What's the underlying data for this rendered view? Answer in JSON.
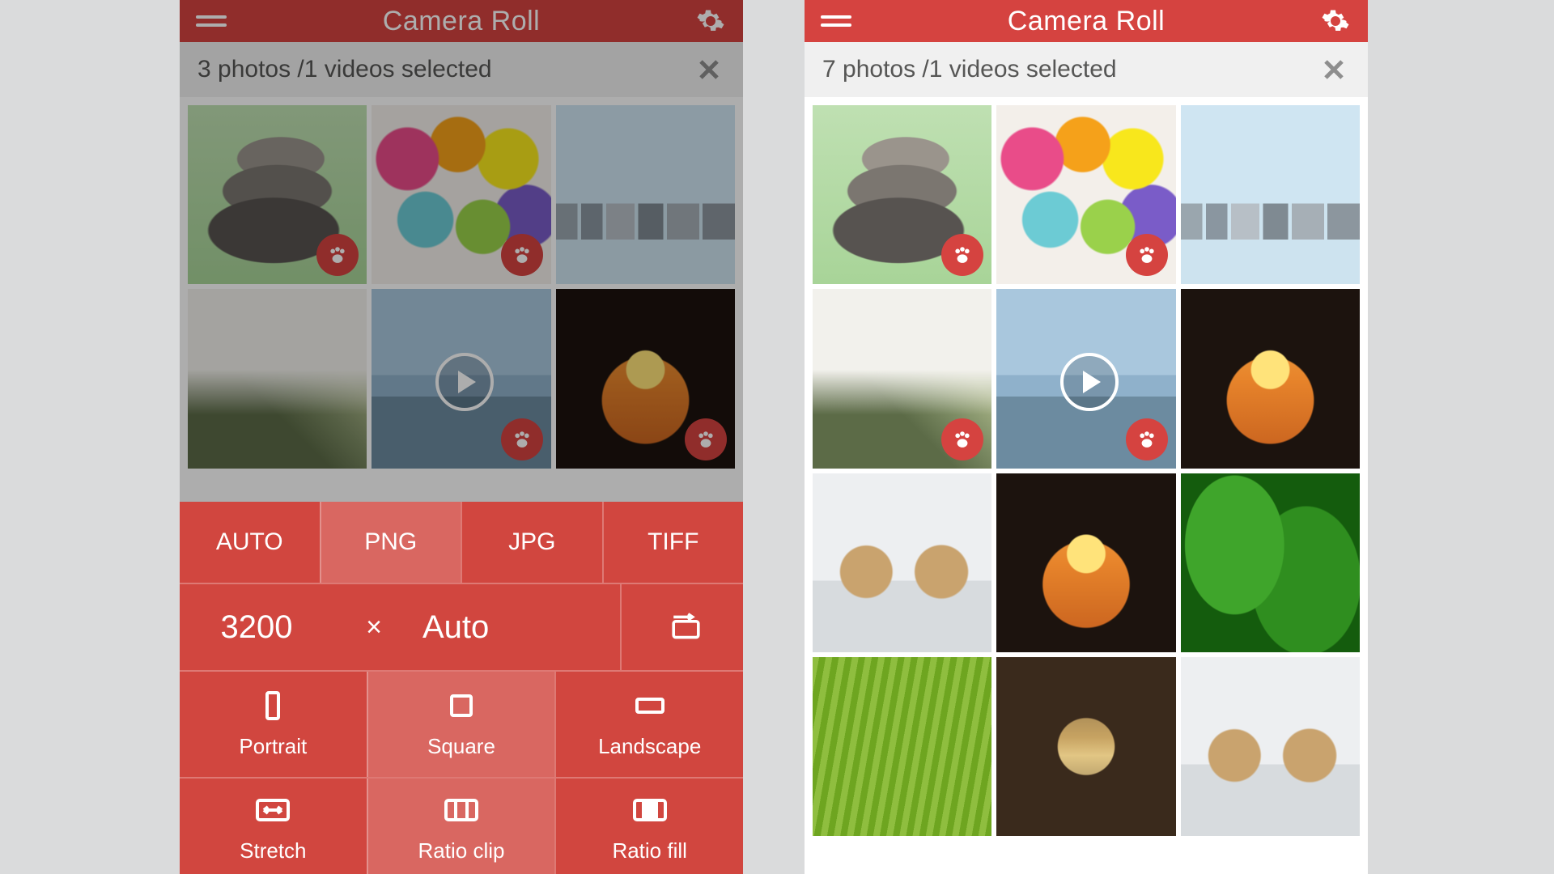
{
  "app": {
    "title": "Camera Roll"
  },
  "left": {
    "selection_text": "3 photos /1 videos selected",
    "thumbs": [
      {
        "art": "t-stones",
        "badge": true
      },
      {
        "art": "t-paint",
        "badge": true
      },
      {
        "art": "t-city"
      },
      {
        "art": "t-wall"
      },
      {
        "art": "t-falls",
        "badge": true,
        "video": true
      },
      {
        "art": "t-hands",
        "badge": true
      }
    ]
  },
  "right": {
    "selection_text": "7 photos /1 videos selected",
    "thumbs": [
      {
        "art": "t-stones",
        "badge": true
      },
      {
        "art": "t-paint",
        "badge": true
      },
      {
        "art": "t-city"
      },
      {
        "art": "t-wall",
        "badge": true
      },
      {
        "art": "t-falls",
        "badge": true,
        "video": true
      },
      {
        "art": "t-hands"
      },
      {
        "art": "t-bears"
      },
      {
        "art": "t-hands"
      },
      {
        "art": "t-leaves"
      },
      {
        "art": "t-grass"
      },
      {
        "art": "t-heartsea"
      },
      {
        "art": "t-bears"
      }
    ]
  },
  "sheet": {
    "formats": [
      "AUTO",
      "PNG",
      "JPG",
      "TIFF"
    ],
    "active_format_index": 1,
    "size": {
      "width": "3200",
      "sep": "×",
      "height": "Auto"
    },
    "orient": [
      {
        "key": "portrait",
        "label": "Portrait"
      },
      {
        "key": "square",
        "label": "Square"
      },
      {
        "key": "landscape",
        "label": "Landscape"
      }
    ],
    "fit": [
      {
        "key": "stretch",
        "label": "Stretch"
      },
      {
        "key": "ratioclip",
        "label": "Ratio clip"
      },
      {
        "key": "ratiofill",
        "label": "Ratio fill"
      }
    ],
    "active_orient_index": 1,
    "active_fit_index": 1
  }
}
